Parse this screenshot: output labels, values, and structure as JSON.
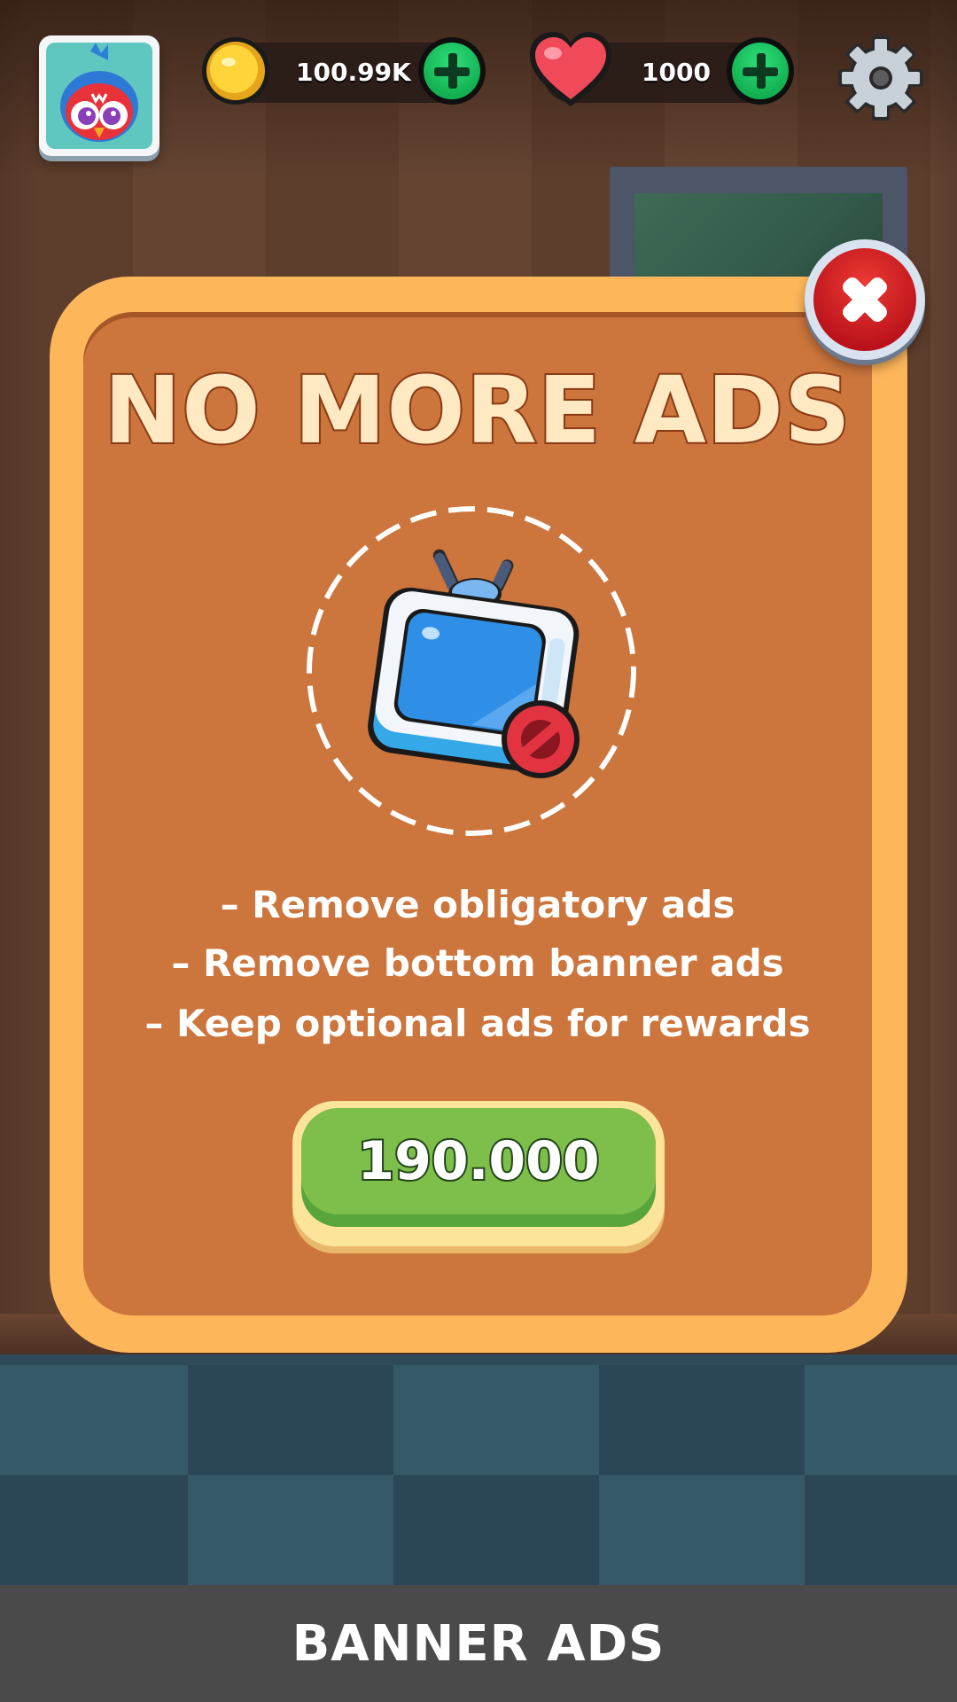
{
  "hud": {
    "coins": {
      "value": "100.99K",
      "icon": "coin-icon",
      "add_icon": "plus-icon"
    },
    "lives": {
      "value": "1000",
      "icon": "heart-icon",
      "add_icon": "plus-icon"
    },
    "settings_icon": "gear-icon",
    "avatar_icon": "bird-avatar-icon"
  },
  "popup": {
    "title": "NO MORE ADS",
    "icon": "no-ads-tv-icon",
    "perks": [
      "– Remove obligatory ads",
      "– Remove bottom banner ads",
      "– Keep optional ads for rewards"
    ],
    "price": "190.000",
    "close_icon": "close-icon"
  },
  "banner": {
    "label": "BANNER ADS"
  },
  "colors": {
    "popup_border": "#fdb65a",
    "popup_fill": "#cc753c",
    "title_fill": "#ffe9c2",
    "price_button": "#7dbf4a",
    "close_button": "#d82a2a",
    "banner_bg": "#4a4a4a"
  }
}
